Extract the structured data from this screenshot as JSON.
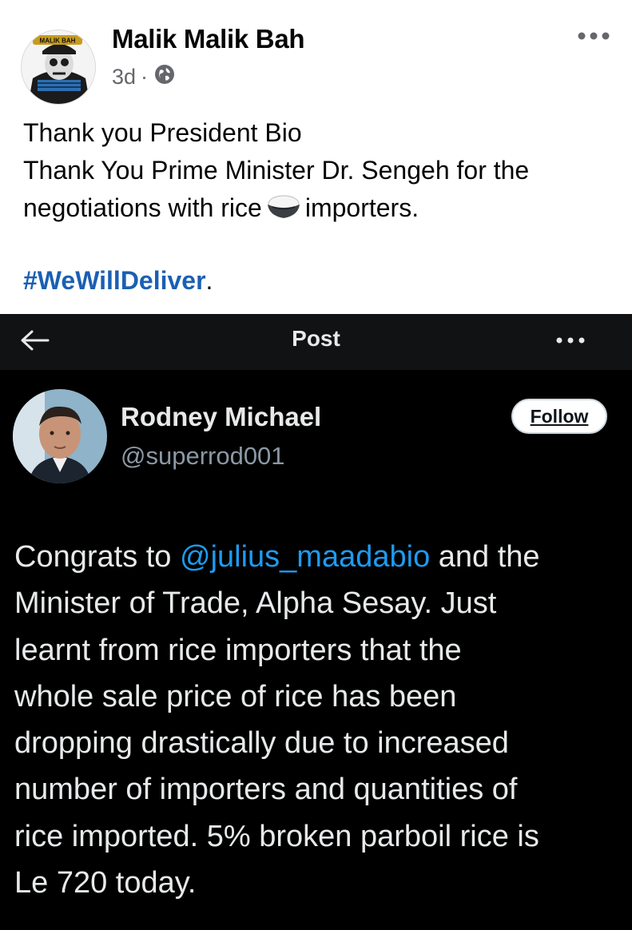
{
  "facebook_post": {
    "author": "Malik Malik Bah",
    "timestamp": "3d",
    "separator": "·",
    "avatar_text": "MALIK BAH",
    "privacy_icon": "globe-icon",
    "more_icon": "more-horizontal-icon",
    "text_lines": [
      "Thank you President Bio",
      "Thank You Prime Minister Dr. Sengeh for the",
      "negotiations with rice"
    ],
    "text_after_emoji": "importers.",
    "emoji": "rice-bowl-icon",
    "hashtag": "#WeWillDeliver",
    "hashtag_suffix": ".",
    "colors": {
      "hashtag": "#1a5fb4",
      "meta": "#65676b"
    }
  },
  "x_post": {
    "header_title": "Post",
    "back_icon": "arrow-left-icon",
    "more_icon": "more-horizontal-icon",
    "author_name": "Rodney Michael",
    "author_handle": "@superrod001",
    "follow_label": "Follow",
    "body_prefix": "Congrats to ",
    "mention": "@julius_maadabio",
    "body_line1_suffix": " and the",
    "body_lines": [
      "Minister of Trade, Alpha Sesay. Just",
      "learnt from rice importers that the",
      "whole sale price of rice has been",
      "dropping drastically due to increased",
      "number of importers and quantities of",
      "rice imported. 5% broken parboil rice is",
      "Le 720 today."
    ],
    "colors": {
      "background": "#000000",
      "mention": "#1d9bf0",
      "handle": "#8b98a5"
    }
  }
}
